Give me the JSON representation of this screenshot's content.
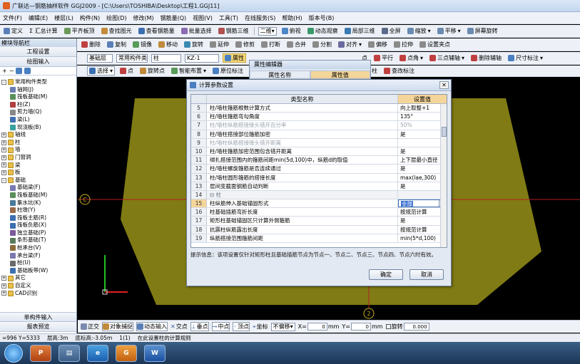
{
  "window": {
    "title": "广联达—钢筋抽样软件 GGJ2009 - [C:\\Users\\TOSHIBA\\Desktop\\工程1.GGJ11]"
  },
  "menu": [
    "文件(F)",
    "编辑(E)",
    "楼层(L)",
    "构件(N)",
    "绘图(D)",
    "修改(M)",
    "钢筋量(Q)",
    "视图(V)",
    "工具(T)",
    "在线服务(S)",
    "帮助(H)",
    "版本号(B)"
  ],
  "toolbar1": [
    "定义",
    "Σ 汇总计算",
    "平齐板顶",
    "查找图元",
    "查看钢筋量",
    "批量选择",
    "钢筋三维",
    "二维",
    "俯视",
    "动态观察",
    "局部三维",
    "全屏",
    "缩放",
    "平移",
    "屏幕旋转"
  ],
  "toolbar2": [
    "删除",
    "复制",
    "镜像",
    "移动",
    "旋转",
    "延伸",
    "修剪",
    "打断",
    "合并",
    "分割",
    "对齐",
    "偏移",
    "拉伸",
    "设置夹点"
  ],
  "toolbar3": {
    "layer": "基础层",
    "type": "常用构件类",
    "member": "柱",
    "name": "KZ-1",
    "property_btn": "属性",
    "right": [
      "点",
      "平行",
      "点角",
      "三点辅轴",
      "删除辅轴",
      "尺寸标注"
    ]
  },
  "toolbar4": [
    "选择",
    "点",
    "旋转点",
    "智能布置",
    "原位标注",
    "动判断边角柱",
    "查改标注"
  ],
  "left_panel": {
    "header": "模块导航栏",
    "buttons": [
      "工程设置",
      "绘图输入"
    ],
    "tree": [
      {
        "indent": 0,
        "box": "-",
        "label": "常用构件类型",
        "type": "folder"
      },
      {
        "indent": 2,
        "label": "轴网(J)",
        "color": "#6a7db0"
      },
      {
        "indent": 2,
        "label": "筏板基础(M)",
        "color": "#5a8f5a"
      },
      {
        "indent": 2,
        "label": "柱(Z)",
        "color": "#b04040"
      },
      {
        "indent": 2,
        "label": "剪力墙(Q)",
        "color": "#888"
      },
      {
        "indent": 2,
        "label": "梁(L)",
        "color": "#3d6fb0"
      },
      {
        "indent": 2,
        "label": "现浇板(B)",
        "color": "#3aa0a0"
      },
      {
        "indent": 0,
        "box": "+",
        "label": "轴线",
        "type": "folder"
      },
      {
        "indent": 0,
        "box": "+",
        "label": "柱",
        "type": "folder"
      },
      {
        "indent": 0,
        "box": "+",
        "label": "墙",
        "type": "folder"
      },
      {
        "indent": 0,
        "box": "+",
        "label": "门窗洞",
        "type": "folder"
      },
      {
        "indent": 0,
        "box": "+",
        "label": "梁",
        "type": "folder"
      },
      {
        "indent": 0,
        "box": "+",
        "label": "板",
        "type": "folder"
      },
      {
        "indent": 0,
        "box": "-",
        "label": "基础",
        "type": "folder"
      },
      {
        "indent": 2,
        "label": "基础梁(F)",
        "color": "#7a7ab0"
      },
      {
        "indent": 2,
        "label": "筏板基础(M)",
        "color": "#5a8f5a"
      },
      {
        "indent": 2,
        "label": "集水坑(K)",
        "color": "#4a7a9a"
      },
      {
        "indent": 2,
        "label": "柱墩(Y)",
        "color": "#9a6a4a"
      },
      {
        "indent": 2,
        "label": "筏板主筋(R)",
        "color": "#3d6fb0"
      },
      {
        "indent": 2,
        "label": "筏板负筋(X)",
        "color": "#3d6fb0"
      },
      {
        "indent": 2,
        "label": "独立基础(P)",
        "color": "#7a5a9a"
      },
      {
        "indent": 2,
        "label": "条形基础(T)",
        "color": "#5a7a5a"
      },
      {
        "indent": 2,
        "label": "桩承台(V)",
        "color": "#8a6a3a"
      },
      {
        "indent": 2,
        "label": "承台梁(F)",
        "color": "#7a7ab0"
      },
      {
        "indent": 2,
        "label": "桩(U)",
        "color": "#6a6a6a"
      },
      {
        "indent": 2,
        "label": "基础板带(W)",
        "color": "#3d6fb0"
      },
      {
        "indent": 0,
        "box": "+",
        "label": "其它",
        "type": "folder"
      },
      {
        "indent": 0,
        "box": "+",
        "label": "自定义",
        "type": "folder"
      },
      {
        "indent": 0,
        "box": "+",
        "label": "CAD识别",
        "type": "folder"
      }
    ],
    "bottom_buttons": [
      "单构件输入",
      "报表预览"
    ]
  },
  "property_window": {
    "title": "属性编辑器",
    "col_name": "属性名称",
    "col_value": "属性值"
  },
  "dialog": {
    "title": "计算参数设置",
    "col_name": "类型名称",
    "col_value": "设置值",
    "rows": [
      {
        "n": "5",
        "name": "柱/墙柱箍筋根数计算方式",
        "value": "向上取整+1",
        "style": ""
      },
      {
        "n": "6",
        "name": "柱/墙柱箍筋弯勾角度",
        "value": "135°",
        "style": ""
      },
      {
        "n": "7",
        "name": "柱/墙柱纵筋搭接接头错开百分率",
        "value": "50%",
        "style": "gray"
      },
      {
        "n": "8",
        "name": "柱/墙柱搭接部位箍筋加密",
        "value": "是",
        "style": ""
      },
      {
        "n": "9",
        "name": "柱/墙柱纵筋搭接接头错开距离",
        "value": "",
        "style": "gray"
      },
      {
        "n": "10",
        "name": "柱/墙柱箍筋加密范围包含错开距离",
        "value": "是",
        "style": ""
      },
      {
        "n": "11",
        "name": "绑扎搭接范围内的箍筋间距min(5d,100)中，纵筋d的取值",
        "value": "上下层最小直径",
        "style": ""
      },
      {
        "n": "12",
        "name": "柱/墙柱螺旋箍筋是否连续通过",
        "value": "是",
        "style": ""
      },
      {
        "n": "13",
        "name": "柱/墙柱圆形箍筋的搭接长度",
        "value": "max(lae,300)",
        "style": ""
      },
      {
        "n": "13",
        "name": "层间变截面钢筋自动判断",
        "value": "是",
        "style": ""
      },
      {
        "n": "14",
        "name": "柱",
        "value": "",
        "style": "cat"
      },
      {
        "n": "15",
        "name": "柱纵筋伸入基础锚固形式",
        "value": "全部",
        "style": "active"
      },
      {
        "n": "16",
        "name": "柱基础插筋弯折长度",
        "value": "按规范计算",
        "style": ""
      },
      {
        "n": "17",
        "name": "矩形柱基础锚固区只计算外侧箍筋",
        "value": "是",
        "style": ""
      },
      {
        "n": "18",
        "name": "抗震柱纵筋露出长度",
        "value": "按规范计算",
        "style": ""
      },
      {
        "n": "19",
        "name": "纵筋搭接范围箍筋间距",
        "value": "min(5*d,100)",
        "style": ""
      }
    ],
    "tip": "提示信息：该项设置仅针对矩形柱且基础插筋节点为节点一、节点二、节点三、节点四、节点六时有效。",
    "ok": "确定",
    "cancel": "取消"
  },
  "canvas": {
    "axis_label_c": "C",
    "axis_label_2": "2"
  },
  "snapbar": {
    "items": [
      "正交",
      "对象捕捉",
      "动态输入",
      "交点",
      "垂点",
      "中点",
      "顶点",
      "坐标"
    ],
    "offset": "不偏移",
    "x_label": "X=",
    "x_value": "0",
    "mm1": "mm",
    "y_label": "Y=",
    "y_value": "0",
    "mm2": "mm",
    "rotate_label": "旋转",
    "rotate_value": "0.000"
  },
  "status": {
    "coords": "=996 Y=5333",
    "floor_height": "层高:3m",
    "bottom_elev": "底标高:-3.05m",
    "count": "1(1)",
    "hint": "在此设置柱的计算规则"
  },
  "colors": {
    "canvas_shape": "#807b14",
    "active_value": "#3a6fd0",
    "header_highlight": "#f4d59a"
  }
}
